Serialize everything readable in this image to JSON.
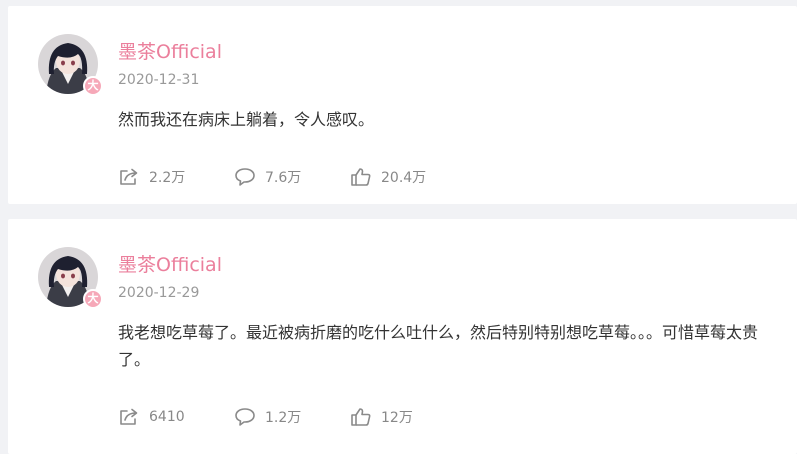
{
  "colors": {
    "username": "#eb7f9c",
    "badge": "#f6a8b8",
    "meta": "#888888",
    "text": "#333333",
    "background": "#f1f2f5"
  },
  "posts": [
    {
      "username": "墨茶Official",
      "badge": "大",
      "date": "2020-12-31",
      "content": "然而我还在病床上躺着，令人感叹。",
      "share_count": "2.2万",
      "comment_count": "7.6万",
      "like_count": "20.4万",
      "icons": [
        "share-icon",
        "comment-icon",
        "like-icon"
      ]
    },
    {
      "username": "墨茶Official",
      "badge": "大",
      "date": "2020-12-29",
      "content": "我老想吃草莓了。最近被病折磨的吃什么吐什么，然后特别特别想吃草莓。。。可惜草莓太贵了。",
      "share_count": "6410",
      "comment_count": "1.2万",
      "like_count": "12万",
      "icons": [
        "share-icon",
        "comment-icon",
        "like-icon"
      ]
    }
  ]
}
